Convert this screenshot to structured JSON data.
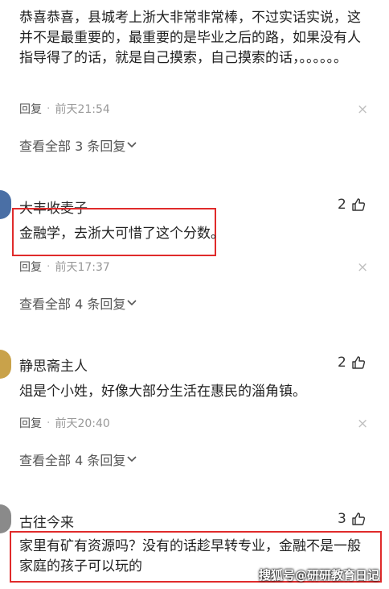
{
  "c1": {
    "text": "恭喜恭喜，县城考上浙大非常非常棒，不过实话实说，这并不是最重要的，最重要的是毕业之后的路，如果没有人指导得了的话，就是自己摸索，自己摸索的话，。。。。。。",
    "reply": "回复",
    "sep": "·",
    "time": "前天21:54",
    "more": "查看全部 3 条回复"
  },
  "c2": {
    "user": "大丰收麦子",
    "likes": "2",
    "text": "金融学，去浙大可惜了这个分数。",
    "reply": "回复",
    "sep": "·",
    "time": "前天17:37",
    "more": "查看全部 4 条回复"
  },
  "c3": {
    "user": "静思斋主人",
    "likes": "2",
    "text": "俎是个小姓，好像大部分生活在惠民的淄角镇。",
    "reply": "回复",
    "sep": "·",
    "time": "前天20:40",
    "more": "查看全部 4 条回复"
  },
  "c4": {
    "user": "古往今来",
    "likes": "3",
    "text": "家里有矿有资源吗？没有的话趁早转专业，金融不是一般家庭的孩子可以玩的"
  },
  "close_glyph": "×",
  "watermark": "搜狐号@研研教育日记",
  "colors": {
    "highlight": "#e02b2b",
    "meta": "#999999"
  }
}
